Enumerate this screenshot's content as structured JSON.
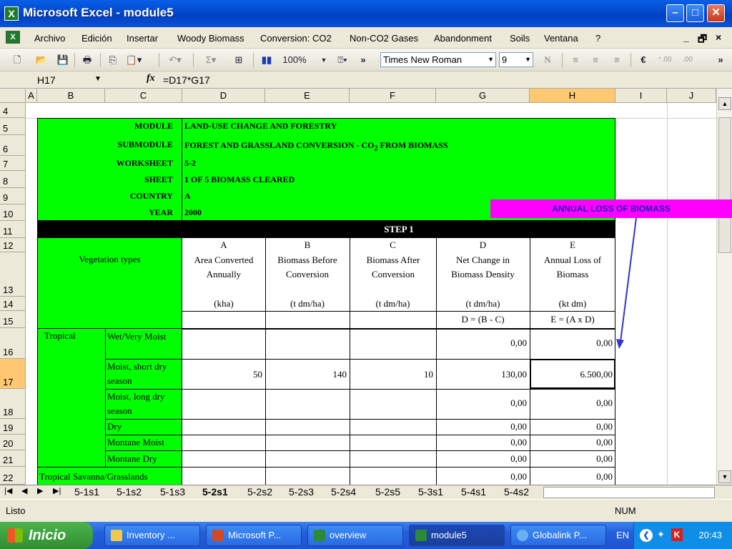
{
  "window": {
    "title": "Microsoft Excel - module5",
    "minimize": "–",
    "maximize": "□",
    "close": "✕"
  },
  "menu": {
    "items": [
      "Archivo",
      "Edición",
      "Insertar",
      "Woody Biomass",
      "Conversion: CO2",
      "Non-CO2 Gases",
      "Abandonment",
      "Soils",
      "Ventana",
      "?"
    ],
    "right_controls": [
      "_",
      "🗗",
      "×"
    ]
  },
  "toolbar": {
    "zoom": "100%",
    "font_name": "Times New Roman",
    "font_size": "9",
    "sum_symbol": "Σ",
    "euro_symbol": "€",
    "chevron": "»",
    "help": "?"
  },
  "formula_bar": {
    "name_box": "H17",
    "fx": "fx",
    "formula": "=D17*G17"
  },
  "columns": [
    "A",
    "B",
    "C",
    "D",
    "E",
    "F",
    "G",
    "H",
    "I",
    "J"
  ],
  "selected_column": "H",
  "rows": [
    "4",
    "5",
    "6",
    "7",
    "8",
    "9",
    "10",
    "11",
    "12",
    "13",
    "14",
    "15",
    "16",
    "17",
    "18",
    "19",
    "20",
    "21",
    "22"
  ],
  "selected_row": "17",
  "header_block": {
    "module_label": "MODULE",
    "module_value": "LAND-USE CHANGE AND FORESTRY",
    "submodule_label": "SUBMODULE",
    "submodule_value": "FOREST AND GRASSLAND CONVERSION - CO",
    "submodule_sub": "2",
    "submodule_tail": " FROM BIOMASS",
    "worksheet_label": "WORKSHEET",
    "worksheet_value": "5-2",
    "sheet_label": "SHEET",
    "sheet_value": "1 OF 5 BIOMASS CLEARED",
    "country_label": "COUNTRY",
    "country_value": "A",
    "year_label": "YEAR",
    "year_value": "2000"
  },
  "step_label": "STEP 1",
  "table_headers": {
    "veg_types": "Vegetation types",
    "letters": [
      "A",
      "B",
      "C",
      "D",
      "E"
    ],
    "titles": [
      "Area Converted Annually",
      "Biomass Before Conversion",
      "Biomass After Conversion",
      "Net Change in Biomass Density",
      "Annual Loss of Biomass"
    ],
    "units": [
      "(kha)",
      "(t dm/ha)",
      "(t dm/ha)",
      "(t dm/ha)",
      "(kt dm)"
    ],
    "formulas": [
      "",
      "",
      "",
      "D = (B - C)",
      "E = (A x D)"
    ]
  },
  "data_rows": [
    {
      "group": "Tropical",
      "type": "Wet/Very Moist",
      "a": "",
      "b": "",
      "c": "",
      "d": "0,00",
      "e": "0,00"
    },
    {
      "group": "",
      "type": "Moist, short dry season",
      "a": "50",
      "b": "140",
      "c": "10",
      "d": "130,00",
      "e": "6.500,00"
    },
    {
      "group": "",
      "type": "Moist, long dry season",
      "a": "",
      "b": "",
      "c": "",
      "d": "0,00",
      "e": "0,00"
    },
    {
      "group": "",
      "type": "Dry",
      "a": "",
      "b": "",
      "c": "",
      "d": "0,00",
      "e": "0,00"
    },
    {
      "group": "",
      "type": "Montane Moist",
      "a": "",
      "b": "",
      "c": "",
      "d": "0,00",
      "e": "0,00"
    },
    {
      "group": "",
      "type": "Montane Dry",
      "a": "",
      "b": "",
      "c": "",
      "d": "0,00",
      "e": "0,00"
    },
    {
      "group": "Tropical Savanna/Grasslands",
      "type": "",
      "a": "",
      "b": "",
      "c": "",
      "d": "0,00",
      "e": "0,00"
    }
  ],
  "annotation": "ANNUAL LOSS OF BIOMASS",
  "sheet_tabs": [
    "5-1s1",
    "5-1s2",
    "5-1s3",
    "5-2s1",
    "5-2s2",
    "5-2s3",
    "5-2s4",
    "5-2s5",
    "5-3s1",
    "5-4s1",
    "5-4s2"
  ],
  "active_tab": "5-2s1",
  "status": {
    "left": "Listo",
    "num": "NUM"
  },
  "taskbar": {
    "start": "Inicio",
    "tasks": [
      "Inventory ...",
      "Microsoft P...",
      "overview",
      "module5",
      "Globalink P..."
    ],
    "active_task": "module5",
    "lang": "EN",
    "time": "20:43"
  },
  "colors": {
    "green": "#00ff00",
    "magenta": "#ff00ff",
    "selected_header": "#ffc873"
  }
}
